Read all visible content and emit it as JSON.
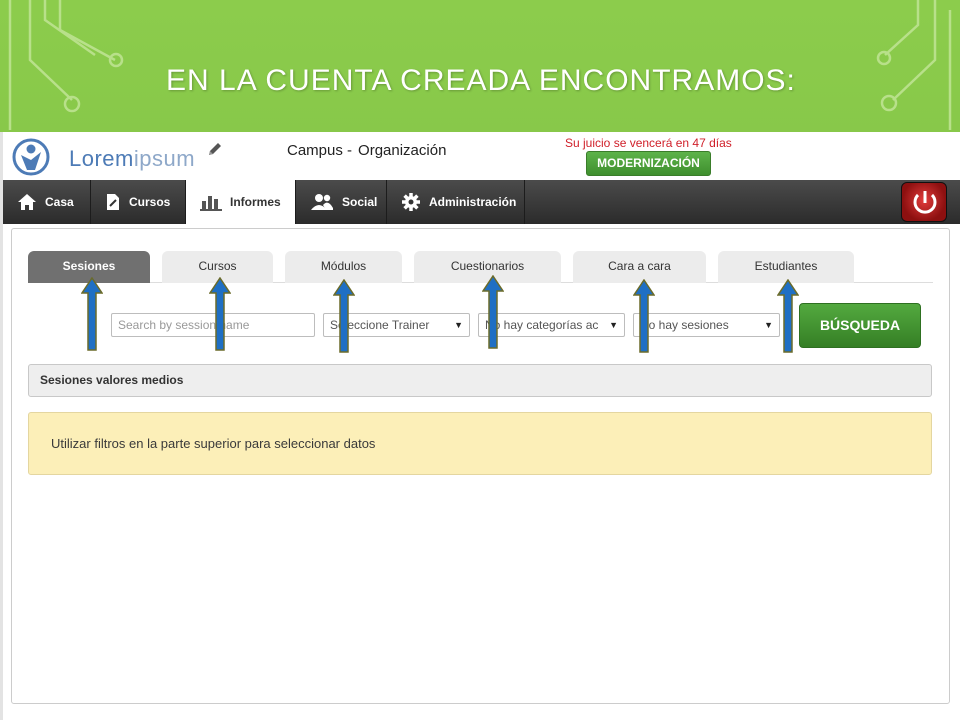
{
  "slide": {
    "title": "EN LA CUENTA CREADA ENCONTRAMOS:"
  },
  "header": {
    "logo_main": "Lorem",
    "logo_accent": "ipsum",
    "campus_label": "Campus -",
    "organization": "Organización",
    "expiry_text": "Su juicio se vencerá en 47 días",
    "modernization_button": "MODERNIZACIÓN"
  },
  "nav": {
    "items": [
      {
        "label": "Casa",
        "icon": "home-icon"
      },
      {
        "label": "Cursos",
        "icon": "document-icon"
      },
      {
        "label": "Informes",
        "icon": "bar-chart-icon",
        "active": true
      },
      {
        "label": "Social",
        "icon": "users-icon"
      },
      {
        "label": "Administración",
        "icon": "gear-icon"
      }
    ],
    "power_icon": "power-icon"
  },
  "tabs": [
    {
      "label": "Sesiones",
      "active": true
    },
    {
      "label": "Cursos"
    },
    {
      "label": "Módulos"
    },
    {
      "label": "Cuestionarios"
    },
    {
      "label": "Cara a cara"
    },
    {
      "label": "Estudiantes"
    }
  ],
  "filters": {
    "search_placeholder": "Search by session name",
    "trainer_select": "Seleccione Trainer",
    "categories_select": "No hay categorías ac",
    "sessions_select": "No hay sesiones",
    "search_button": "BÚSQUEDA"
  },
  "panel": {
    "averages_title": "Sesiones valores medios",
    "filter_hint": "Utilizar filtros en la parte superior para seleccionar datos"
  },
  "colors": {
    "slide_green": "#7fbf45",
    "nav_dark": "#2b2b2b",
    "expiry_red": "#d0202a",
    "button_green": "#3f8f2e",
    "alert_yellow": "#fcefb8",
    "arrow_blue": "#1f6fc4"
  }
}
